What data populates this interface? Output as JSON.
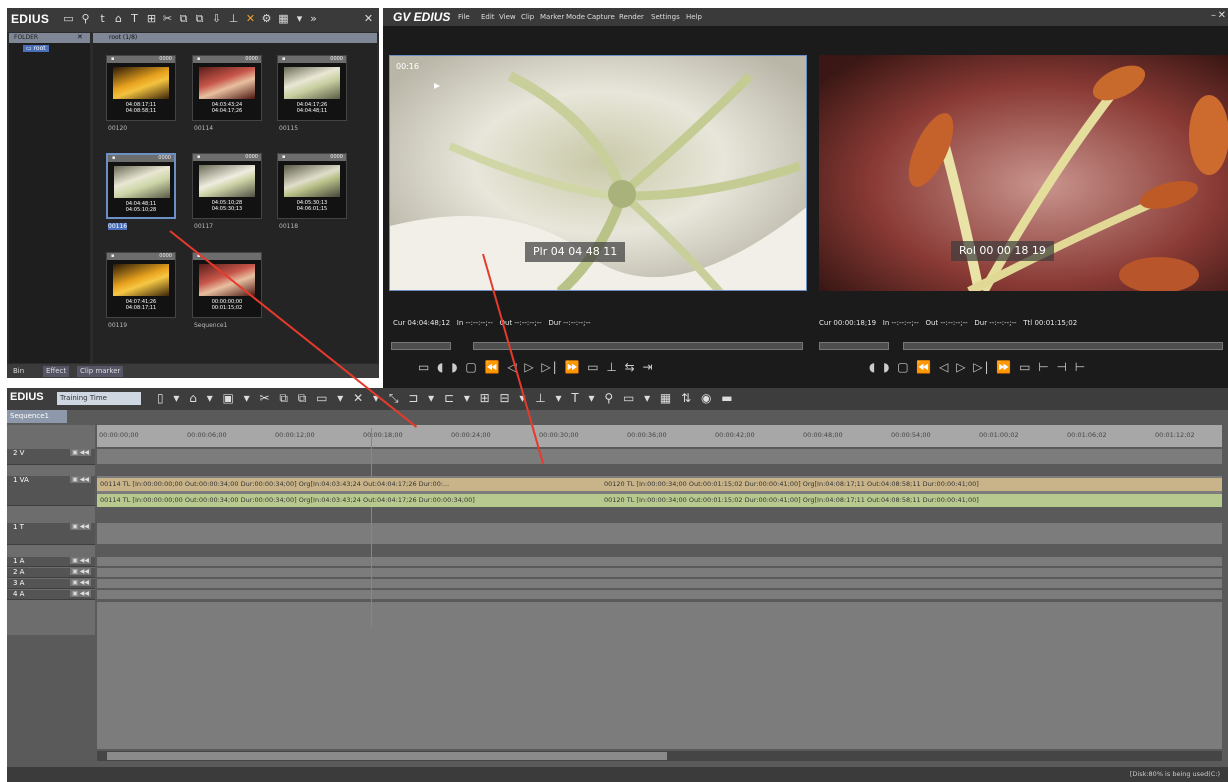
{
  "bin": {
    "app_name": "EDIUS",
    "folder_title": "FOLDER",
    "folder_root": "root",
    "clip_path": "root (1/8)",
    "clips": [
      {
        "name": "00120",
        "tc_in": "04:08:17;11",
        "tc_out": "04:08:58;11",
        "badge": "0000"
      },
      {
        "name": "00114",
        "tc_in": "04:03:43;24",
        "tc_out": "04:04:17;26",
        "badge": "0000"
      },
      {
        "name": "00115",
        "tc_in": "04:04:17;26",
        "tc_out": "04:04:48;11",
        "badge": "0000"
      },
      {
        "name": "00116",
        "tc_in": "04:04:48;11",
        "tc_out": "04:05:10;28",
        "badge": "0000"
      },
      {
        "name": "00117",
        "tc_in": "04:05:10;28",
        "tc_out": "04:05:30;13",
        "badge": "0000"
      },
      {
        "name": "00118",
        "tc_in": "04:05:30;13",
        "tc_out": "04:06:01;15",
        "badge": "0000"
      },
      {
        "name": "00119",
        "tc_in": "04:07:41;26",
        "tc_out": "04:08:17;11",
        "badge": "0000"
      },
      {
        "name": "Sequence1",
        "tc_in": "00:00:00;00",
        "tc_out": "00:01:15;02",
        "badge": ""
      }
    ],
    "tabs": [
      "Bin",
      "Effect",
      "Clip marker"
    ]
  },
  "preview": {
    "app_name": "EDIUS",
    "menu": [
      "File",
      "Edit",
      "View",
      "Clip",
      "Marker",
      "Mode",
      "Capture",
      "Render",
      "Settings",
      "Help"
    ],
    "player_label": "00:16",
    "player_tc": "Plr 04 04 48 11",
    "recorder_tc": "Rol 00 00 18 19",
    "player_status": "Cur 04:04:48;12   In --:--:--;--   Out --:--:--;--   Dur --:--:--;--",
    "recorder_status": "Cur 00:00:18;19   In --:--:--;--   Out --:--:--;--   Dur --:--:--;--   Ttl 00:01:15;02"
  },
  "timeline": {
    "app_name": "EDIUS",
    "project": "Training Time",
    "sequence": "Sequence1",
    "ticks": [
      "00:00:00;00",
      "00:00:06;00",
      "00:00:12;00",
      "00:00:18;00",
      "00:00:24;00",
      "00:00:30;00",
      "00:00:36;00",
      "00:00:42;00",
      "00:00:48;00",
      "00:00:54;00",
      "00:01:00;02",
      "00:01:06;02",
      "00:01:12;02"
    ],
    "tracks": [
      "2 V",
      "1 VA",
      "1 T",
      "1 A",
      "2 A",
      "3 A",
      "4 A"
    ],
    "clip1_video": "00114  TL [In:00:00:00;00 Out:00:00:34;00 Dur:00:00:34;00]  Org[In:04:03:43;24 Out:04:04:17;26 Dur:00:...",
    "clip1_audio": "00114  TL [In:00:00:00;00 Out:00:00:34;00 Dur:00:00:34;00]  Org[In:04:03:43;24 Out:04:04:17;26 Dur:00:00:34;00]",
    "clip2_video": "00120  TL [In:00:00:34;00 Out:00:01:15;02 Dur:00:00:41;00]  Org[In:04:08:17;11 Out:04:08:58;11 Dur:00:00:41;00]",
    "clip2_audio": "00120  TL [In:00:00:34;00 Out:00:01:15;02 Dur:00:00:41;00]  Org[In:04:08:17;11 Out:04:08:58;11 Dur:00:00:41;00]",
    "disk_status": "[Disk:80% is being used(C:)"
  },
  "colors": {
    "arrow": "#e53a2c",
    "clip_video": "#c9b48a",
    "clip_audio": "#b8c98f",
    "selection": "#6c8fc4"
  }
}
